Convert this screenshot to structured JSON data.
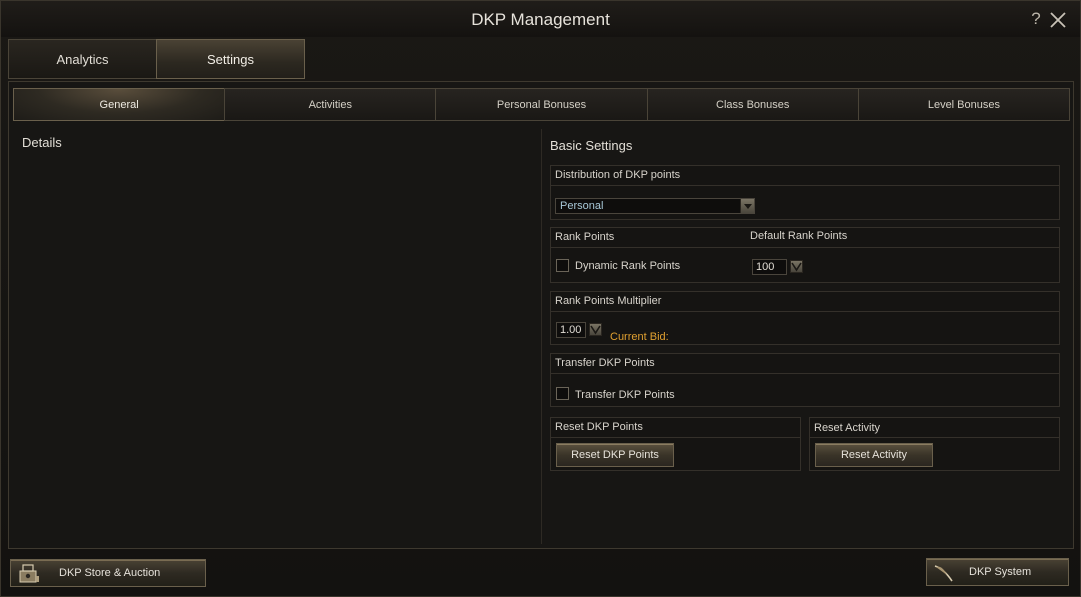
{
  "window": {
    "title": "DKP Management"
  },
  "main_tabs": [
    {
      "label": "Analytics",
      "active": false
    },
    {
      "label": "Settings",
      "active": true
    }
  ],
  "sub_tabs": [
    {
      "label": "General",
      "active": true
    },
    {
      "label": "Activities",
      "active": false
    },
    {
      "label": "Personal Bonuses",
      "active": false
    },
    {
      "label": "Class Bonuses",
      "active": false
    },
    {
      "label": "Level Bonuses",
      "active": false
    }
  ],
  "details": {
    "heading": "Details"
  },
  "basic_settings": {
    "heading": "Basic Settings",
    "distribution": {
      "label": "Distribution of DKP points",
      "selected": "Personal"
    },
    "rank_points": {
      "label": "Rank Points",
      "dynamic_label": "Dynamic Rank Points",
      "default_label": "Default Rank Points",
      "default_value": "100"
    },
    "multiplier": {
      "label": "Rank Points Multiplier",
      "value": "1.00"
    },
    "transfer": {
      "label": "Transfer DKP Points",
      "checkbox_label": "Transfer DKP Points"
    },
    "reset_dkp": {
      "label": "Reset DKP Points",
      "button": "Reset DKP Points"
    },
    "reset_activity": {
      "label": "Reset Activity",
      "button": "Reset Activity"
    }
  },
  "overlay": {
    "current_bid": "Current Bid:"
  },
  "footer": {
    "store_button": "DKP Store & Auction",
    "system_button": "DKP System"
  }
}
